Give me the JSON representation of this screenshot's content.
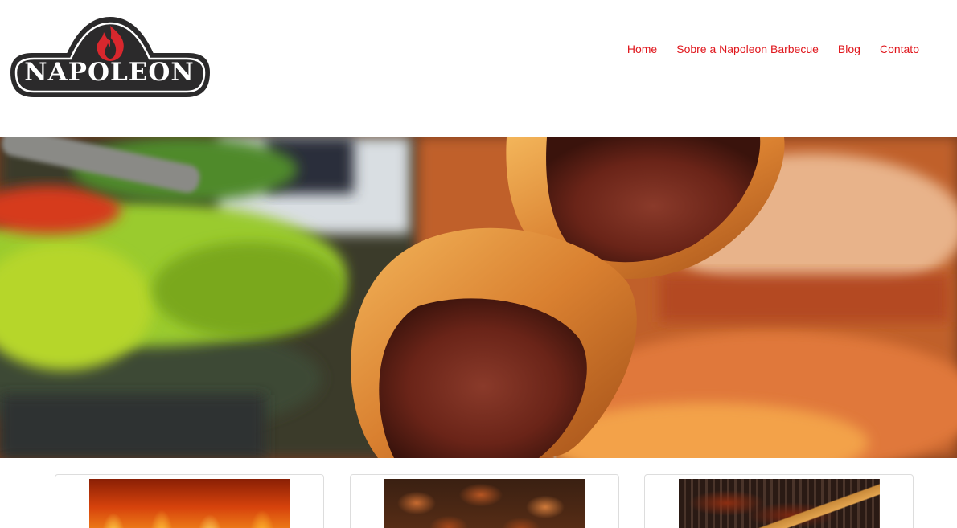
{
  "brand": {
    "logo_text": "NAPOLEON",
    "logo_color": "#2b2a2b",
    "flame_color": "#d8272d"
  },
  "nav": {
    "items": [
      {
        "label": "Home"
      },
      {
        "label": "Sobre a Napoleon Barbecue"
      },
      {
        "label": "Blog"
      },
      {
        "label": "Contato"
      }
    ],
    "link_color": "#e0161c"
  },
  "hero": {
    "image": "grilled-picanha-skewer-photo"
  },
  "cards": [
    {
      "image": "grill-flames-photo"
    },
    {
      "image": "grilled-chicken-photo"
    },
    {
      "image": "bbq-ribs-brush-photo"
    }
  ]
}
